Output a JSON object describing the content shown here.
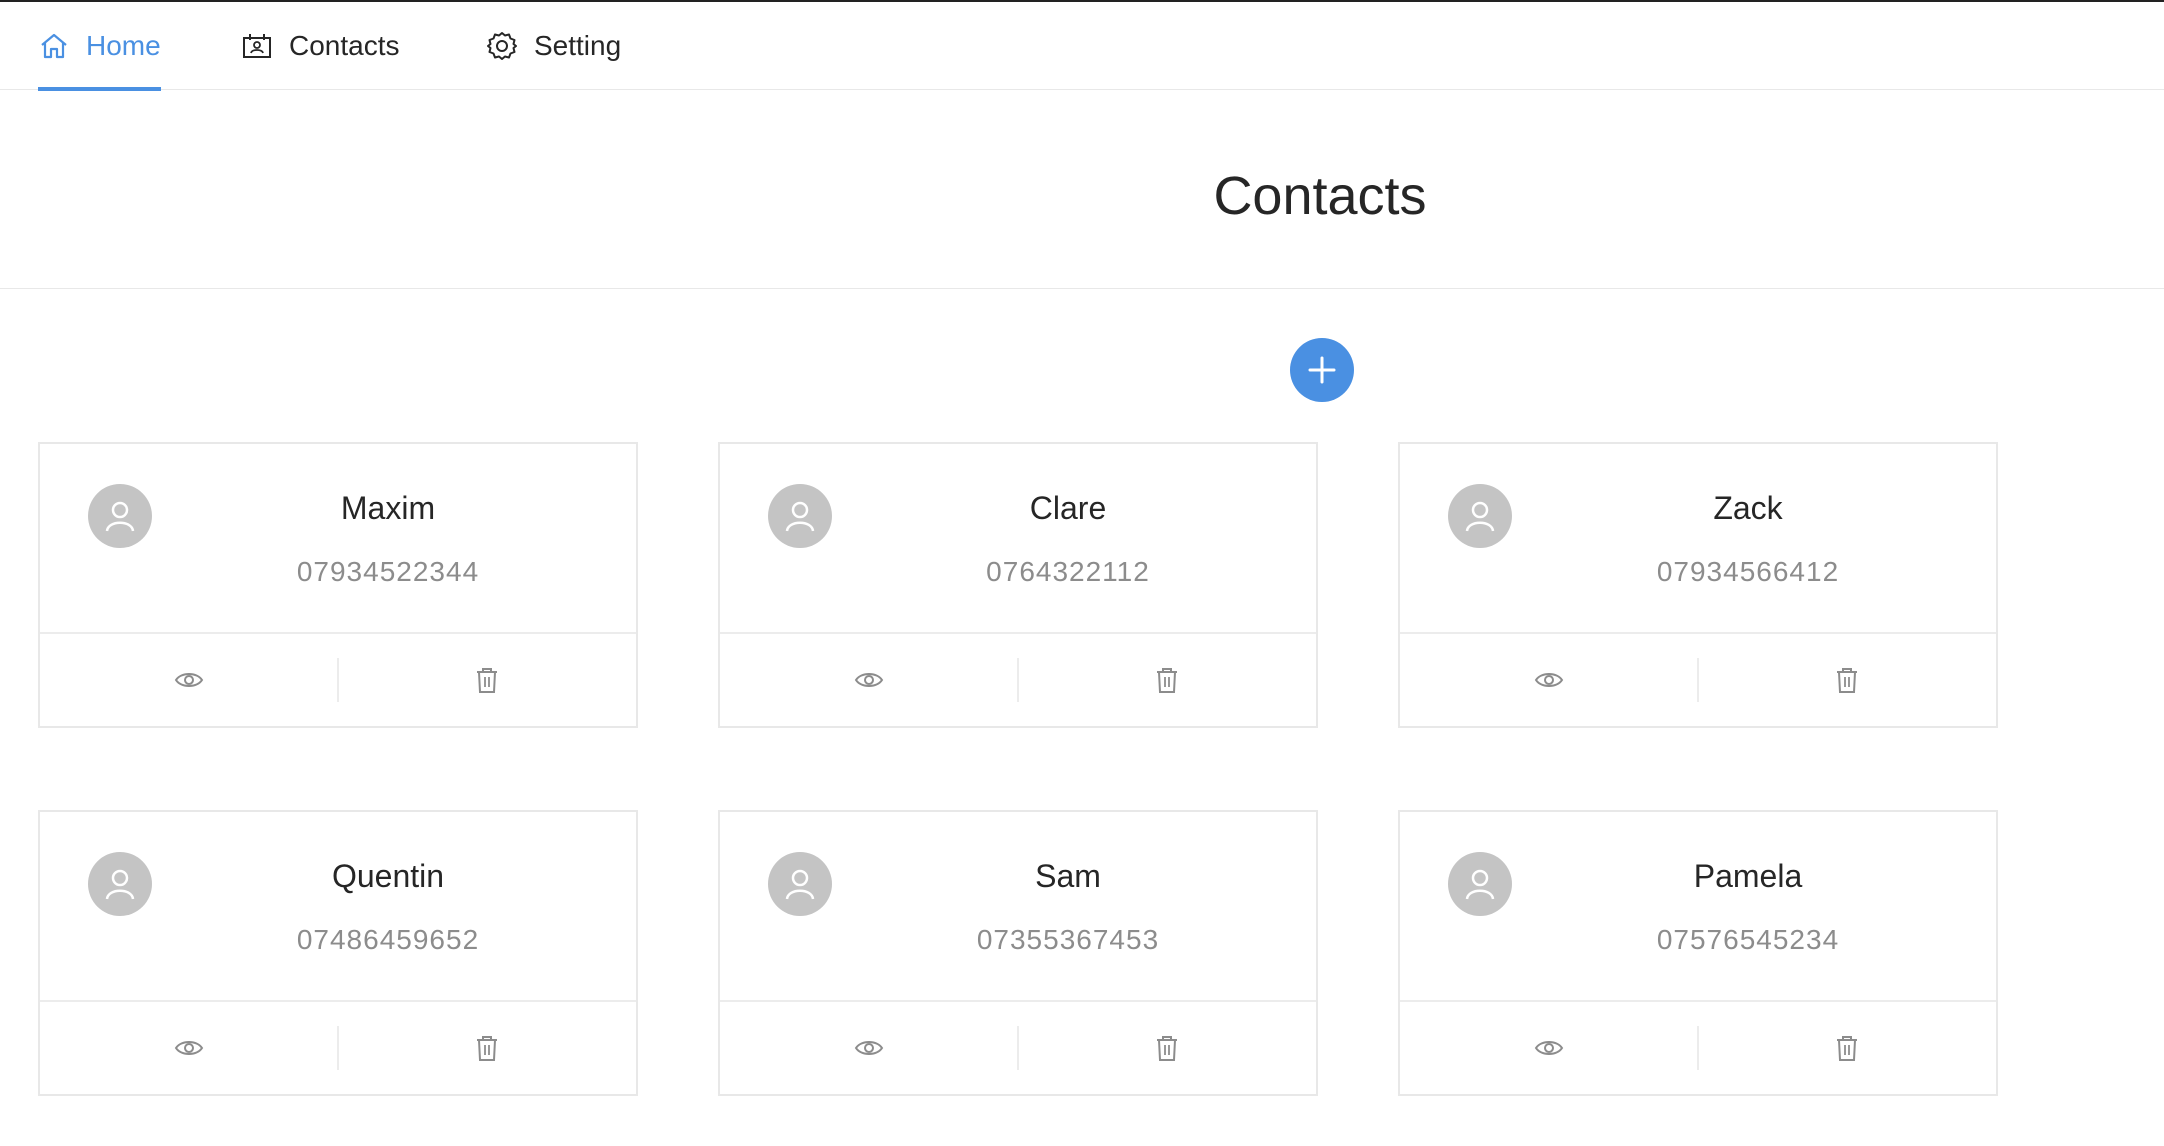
{
  "nav": {
    "items": [
      {
        "label": "Home",
        "icon": "home-icon",
        "active": true
      },
      {
        "label": "Contacts",
        "icon": "contact-card-icon",
        "active": false
      },
      {
        "label": "Setting",
        "icon": "gear-icon",
        "active": false
      }
    ]
  },
  "page": {
    "title": "Contacts",
    "add_button_icon": "plus-icon"
  },
  "contacts": [
    {
      "name": "Maxim",
      "phone": "07934522344"
    },
    {
      "name": "Clare",
      "phone": "0764322112"
    },
    {
      "name": "Zack",
      "phone": "07934566412"
    },
    {
      "name": "Quentin",
      "phone": "07486459652"
    },
    {
      "name": "Sam",
      "phone": "07355367453"
    },
    {
      "name": "Pamela",
      "phone": "07576545234"
    }
  ],
  "card_actions": {
    "view_icon": "eye-icon",
    "delete_icon": "trash-icon"
  },
  "colors": {
    "accent": "#4a90e2",
    "avatar_bg": "#c4c4c4",
    "border": "#e8e8e8",
    "muted_text": "#8c8c8c"
  }
}
